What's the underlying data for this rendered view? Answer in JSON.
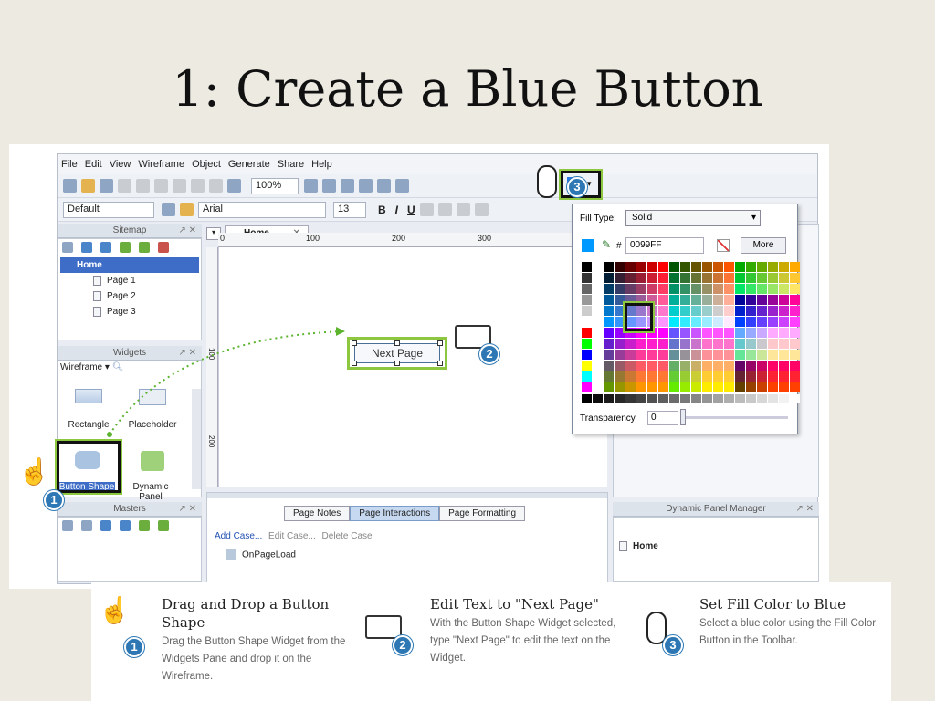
{
  "slide": {
    "title": "1: Create a Blue Button"
  },
  "app": {
    "menu": [
      "File",
      "Edit",
      "View",
      "Wireframe",
      "Object",
      "Generate",
      "Share",
      "Help"
    ],
    "toolbar": {
      "zoom": "100%",
      "style": "Default",
      "font": "Arial",
      "size": "13"
    },
    "sitemap": {
      "title": "Sitemap",
      "items": [
        "Home",
        "Page 1",
        "Page 2",
        "Page 3"
      ]
    },
    "widgets": {
      "title": "Widgets",
      "library": "Wireframe",
      "items": [
        "Rectangle",
        "Placeholder",
        "Button Shape",
        "Dynamic Panel"
      ]
    },
    "masters": {
      "title": "Masters"
    },
    "canvas": {
      "tab": "Home",
      "ruler": [
        "0",
        "100",
        "200",
        "300"
      ],
      "vruler": [
        "100",
        "200"
      ],
      "widget_text": "Next Page"
    },
    "bottom_tabs": [
      "Page Notes",
      "Page Interactions",
      "Page Formatting"
    ],
    "interactions": {
      "add": "Add Case...",
      "edit": "Edit Case...",
      "delete": "Delete Case",
      "event": "OnPageLoad"
    },
    "dpm": {
      "title": "Dynamic Panel Manager",
      "item": "Home"
    },
    "fill": {
      "fill_type_label": "Fill Type:",
      "fill_type": "Solid",
      "hash": "#",
      "hex": "0099FF",
      "more": "More",
      "transparency_label": "Transparency",
      "transparency": "0",
      "accent": "#0099FF"
    }
  },
  "badges": [
    "1",
    "2",
    "3"
  ],
  "steps": [
    {
      "title": "Drag and Drop a Button Shape",
      "desc": "Drag the Button Shape Widget from the Widgets Pane and drop it on the Wireframe.",
      "icon": "hand-icon"
    },
    {
      "title": "Edit Text to \"Next Page\"",
      "desc": "With the Button Shape Widget selected, type \"Next Page\" to edit the text on the Widget.",
      "icon": "keyboard-icon"
    },
    {
      "title": "Set Fill Color to Blue",
      "desc": "Select a blue color using the Fill Color Button in the Toolbar.",
      "icon": "mouse-icon"
    }
  ]
}
